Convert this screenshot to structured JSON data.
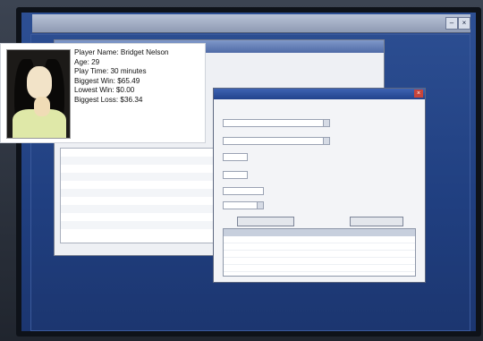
{
  "player_card": {
    "lines": [
      "Player Name: Bridget Nelson",
      "Age: 29",
      "Play Time: 30 minutes",
      "Biggest Win: $65.49",
      "Lowest Win: $0.00",
      "Biggest Loss: $36.34"
    ]
  },
  "outer_window": {
    "title": ""
  },
  "back_window": {
    "title": ""
  },
  "dialog": {
    "title": ""
  }
}
